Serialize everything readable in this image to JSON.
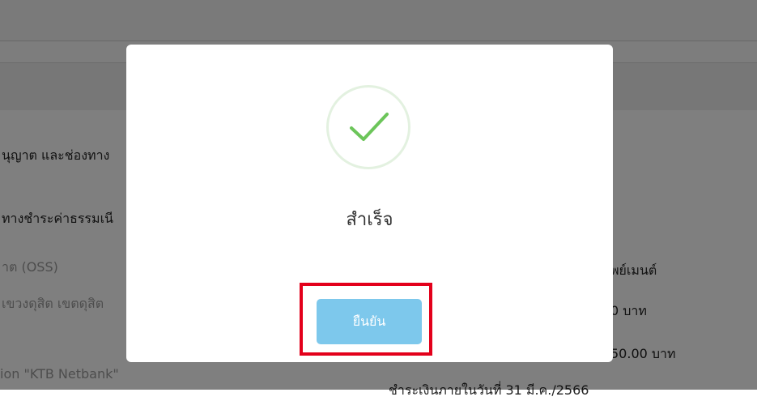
{
  "background": {
    "lines": [
      "นุญาต และช่องทาง",
      "ทางชำระค่าธรรมเนี",
      "าต (OSS)",
      "เขวงดุสิต เขตดุสิต",
      "ion \"KTB Netbank\"",
      "พย์เมนต์",
      "0 บาท",
      "50.00 บาท",
      "ชำระเงินภายในวันที่ 31 มี.ค./2566"
    ]
  },
  "modal": {
    "icon": "checkmark-icon",
    "title": "สำเร็จ",
    "confirm_label": "ยืนยัน"
  },
  "colors": {
    "accent_button": "#7dc8ec",
    "check_green": "#6cc55a",
    "highlight_red": "#e3001b"
  }
}
